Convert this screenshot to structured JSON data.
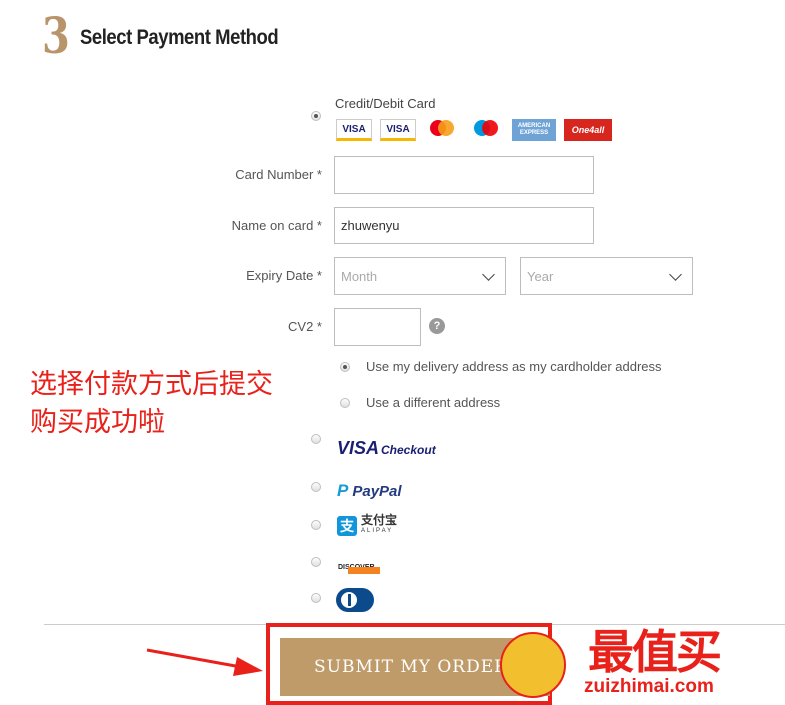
{
  "header": {
    "step_number": "3",
    "title": "Select Payment Method"
  },
  "card_option": {
    "label": "Credit/Debit Card",
    "logos": [
      "VISA",
      "VISA",
      "mastercard",
      "maestro",
      "AMERICAN EXPRESS",
      "One4all"
    ]
  },
  "form": {
    "card_number": {
      "label": "Card Number *",
      "value": ""
    },
    "name_on_card": {
      "label": "Name on card *",
      "value": "zhuwenyu"
    },
    "expiry": {
      "label": "Expiry Date *",
      "month_placeholder": "Month",
      "year_placeholder": "Year"
    },
    "cv2": {
      "label": "CV2 *",
      "help": "?"
    },
    "address_options": [
      "Use my delivery address as my cardholder address",
      "Use a different address"
    ]
  },
  "other_methods": {
    "visa_checkout": {
      "brand": "VISA",
      "suffix": "Checkout"
    },
    "paypal": {
      "brand": "PayPal"
    },
    "alipay": {
      "cn": "支付宝",
      "en": "ALIPAY"
    },
    "discover": {
      "brand": "DISCOVER"
    }
  },
  "annotation": {
    "line1": "选择付款方式后提交",
    "line2": "购买成功啦"
  },
  "submit": {
    "label": "SUBMIT MY ORDER"
  },
  "watermark": {
    "cn": "最值买",
    "url": "zuizhimai.com"
  },
  "colors": {
    "accent": "#bf9b6a",
    "annotation": "#e8211b",
    "paypal_blue": "#253b80",
    "visa_blue": "#1a1f71"
  }
}
